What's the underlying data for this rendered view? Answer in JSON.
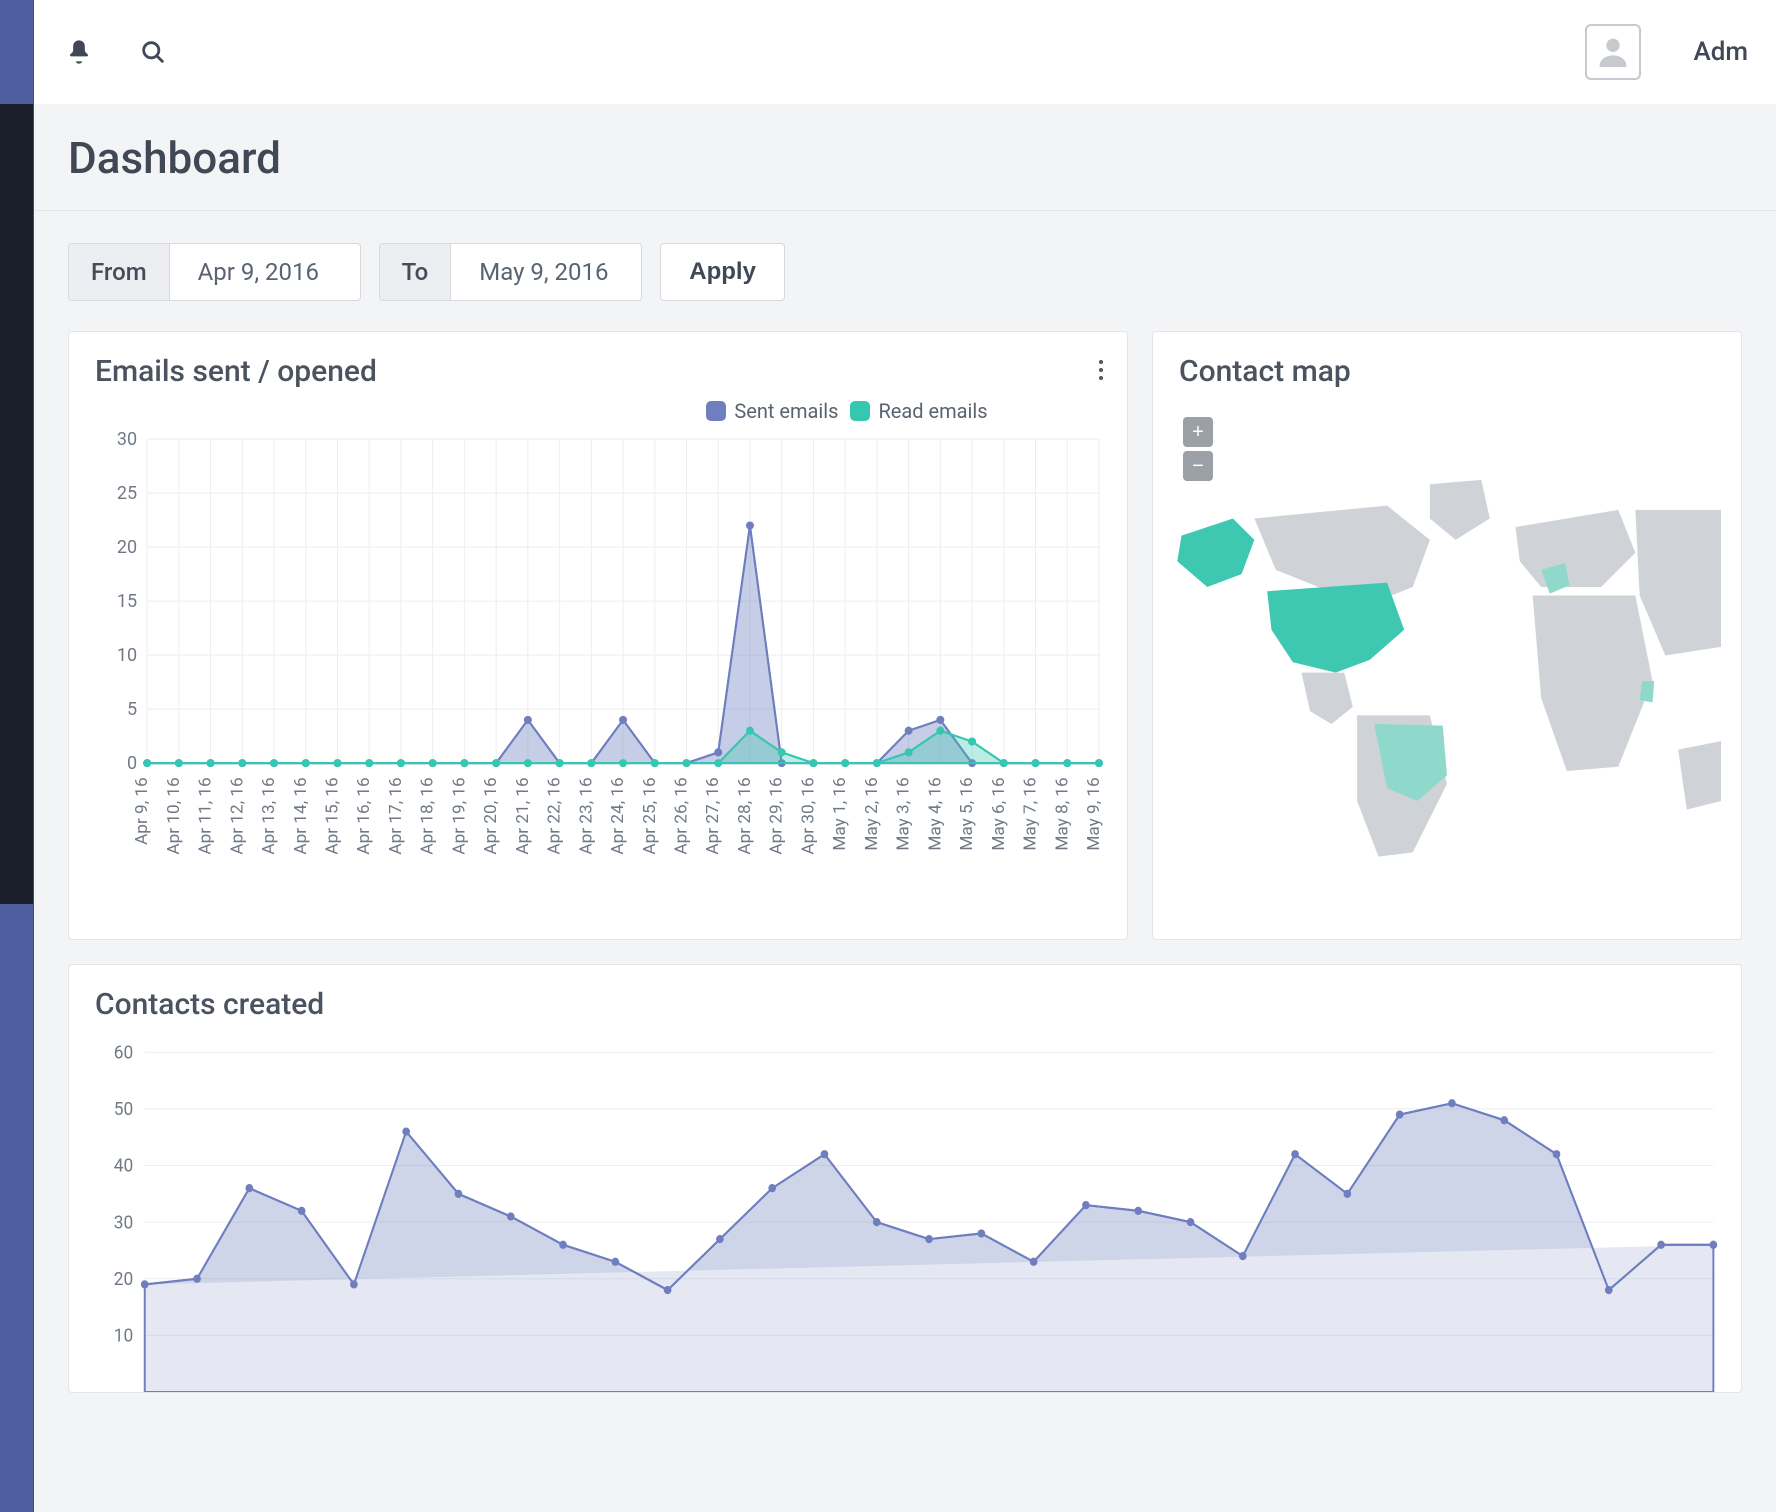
{
  "topbar": {
    "user_label": "Adm"
  },
  "page": {
    "title": "Dashboard"
  },
  "filter": {
    "from_label": "From",
    "from_value": "Apr 9, 2016",
    "to_label": "To",
    "to_value": "May 9, 2016",
    "apply_label": "Apply"
  },
  "emails_card": {
    "title": "Emails sent / opened",
    "legend": {
      "sent": "Sent emails",
      "read": "Read emails"
    },
    "colors": {
      "sent": "#6e7ebe",
      "read": "#36c7b0"
    }
  },
  "map_card": {
    "title": "Contact map",
    "highlighted_regions": [
      "United States",
      "Alaska",
      "France",
      "Brazil"
    ]
  },
  "contacts_card": {
    "title": "Contacts created"
  },
  "chart_data": [
    {
      "id": "emails",
      "type": "line",
      "title": "Emails sent / opened",
      "xlabel": "",
      "ylabel": "",
      "ylim": [
        0,
        30
      ],
      "yticks": [
        0,
        5,
        10,
        15,
        20,
        25,
        30
      ],
      "categories": [
        "Apr 9, 16",
        "Apr 10, 16",
        "Apr 11, 16",
        "Apr 12, 16",
        "Apr 13, 16",
        "Apr 14, 16",
        "Apr 15, 16",
        "Apr 16, 16",
        "Apr 17, 16",
        "Apr 18, 16",
        "Apr 19, 16",
        "Apr 20, 16",
        "Apr 21, 16",
        "Apr 22, 16",
        "Apr 23, 16",
        "Apr 24, 16",
        "Apr 25, 16",
        "Apr 26, 16",
        "Apr 27, 16",
        "Apr 28, 16",
        "Apr 29, 16",
        "Apr 30, 16",
        "May 1, 16",
        "May 2, 16",
        "May 3, 16",
        "May 4, 16",
        "May 5, 16",
        "May 6, 16",
        "May 7, 16",
        "May 8, 16",
        "May 9, 16"
      ],
      "series": [
        {
          "name": "Sent emails",
          "color": "#6e7ebe",
          "values": [
            0,
            0,
            0,
            0,
            0,
            0,
            0,
            0,
            0,
            0,
            0,
            0,
            4,
            0,
            0,
            4,
            0,
            0,
            1,
            22,
            0,
            0,
            0,
            0,
            3,
            4,
            0,
            0,
            0,
            0,
            0
          ]
        },
        {
          "name": "Read emails",
          "color": "#36c7b0",
          "values": [
            0,
            0,
            0,
            0,
            0,
            0,
            0,
            0,
            0,
            0,
            0,
            0,
            0,
            0,
            0,
            0,
            0,
            0,
            0,
            3,
            1,
            0,
            0,
            0,
            1,
            3,
            2,
            0,
            0,
            0,
            0
          ]
        }
      ]
    },
    {
      "id": "contacts",
      "type": "area",
      "title": "Contacts created",
      "xlabel": "",
      "ylabel": "",
      "ylim": [
        0,
        60
      ],
      "yticks": [
        10,
        20,
        30,
        40,
        50,
        60
      ],
      "x": [
        0,
        1,
        2,
        3,
        4,
        5,
        6,
        7,
        8,
        9,
        10,
        11,
        12,
        13,
        14,
        15,
        16,
        17,
        18,
        19,
        20,
        21,
        22,
        23,
        24,
        25,
        26,
        27,
        28,
        29,
        30
      ],
      "series": [
        {
          "name": "Contacts created",
          "color": "#6e7ebe",
          "values": [
            19,
            20,
            36,
            32,
            19,
            46,
            35,
            31,
            26,
            23,
            18,
            27,
            36,
            42,
            30,
            27,
            28,
            23,
            33,
            32,
            30,
            24,
            42,
            35,
            49,
            51,
            48,
            42,
            18,
            26,
            26
          ]
        }
      ]
    }
  ]
}
